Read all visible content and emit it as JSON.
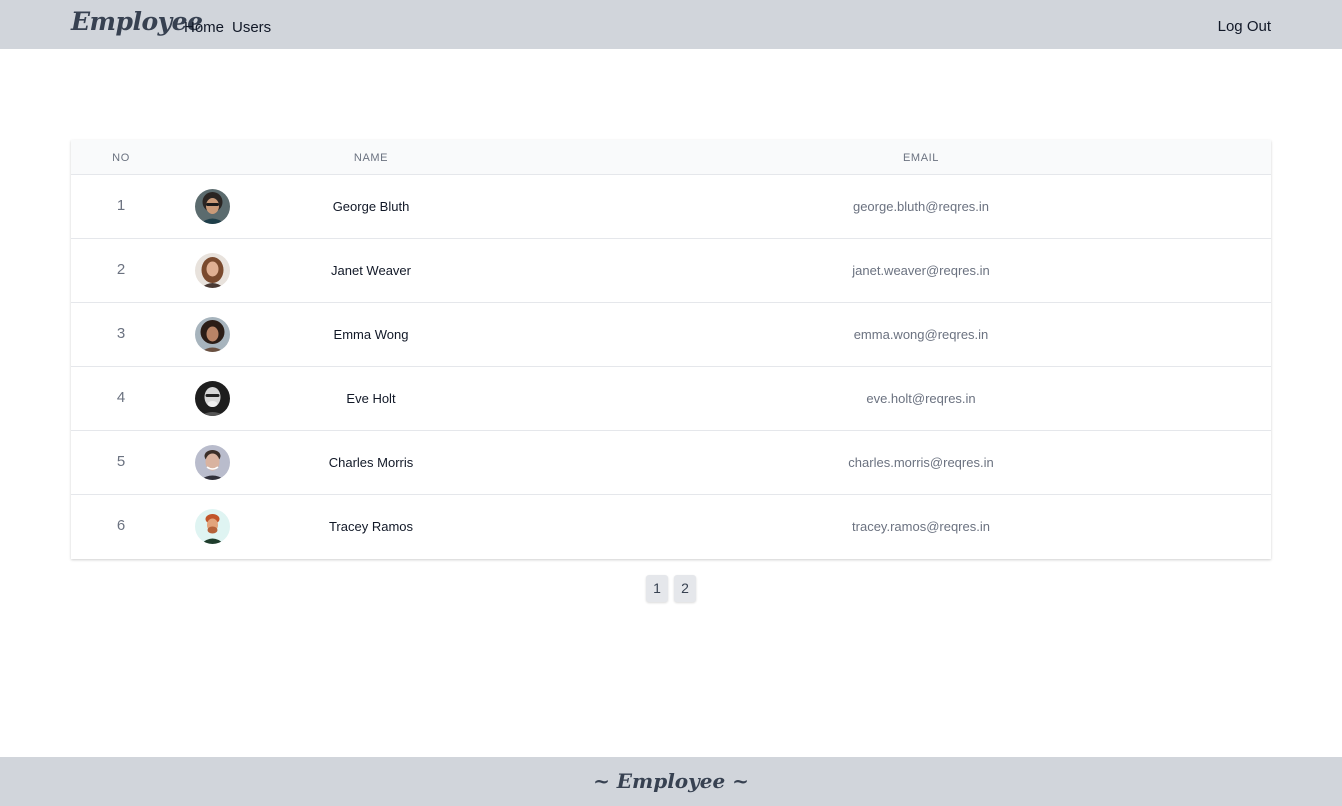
{
  "nav": {
    "brand": "Employee",
    "links": [
      "Home",
      "Users"
    ],
    "logout": "Log Out"
  },
  "table": {
    "headers": {
      "no": "NO",
      "name": "NAME",
      "email": "EMAIL"
    },
    "rows": [
      {
        "no": "1",
        "name": "George Bluth",
        "email": "george.bluth@reqres.in"
      },
      {
        "no": "2",
        "name": "Janet Weaver",
        "email": "janet.weaver@reqres.in"
      },
      {
        "no": "3",
        "name": "Emma Wong",
        "email": "emma.wong@reqres.in"
      },
      {
        "no": "4",
        "name": "Eve Holt",
        "email": "eve.holt@reqres.in"
      },
      {
        "no": "5",
        "name": "Charles Morris",
        "email": "charles.morris@reqres.in"
      },
      {
        "no": "6",
        "name": "Tracey Ramos",
        "email": "tracey.ramos@reqres.in"
      }
    ]
  },
  "pagination": {
    "pages": [
      "1",
      "2"
    ]
  },
  "footer": {
    "text": "~ Employee ~"
  },
  "colors": {
    "nav_bg": "#d1d5db",
    "footer_bg": "#d1d5db",
    "header_bg": "#f9fafb"
  }
}
